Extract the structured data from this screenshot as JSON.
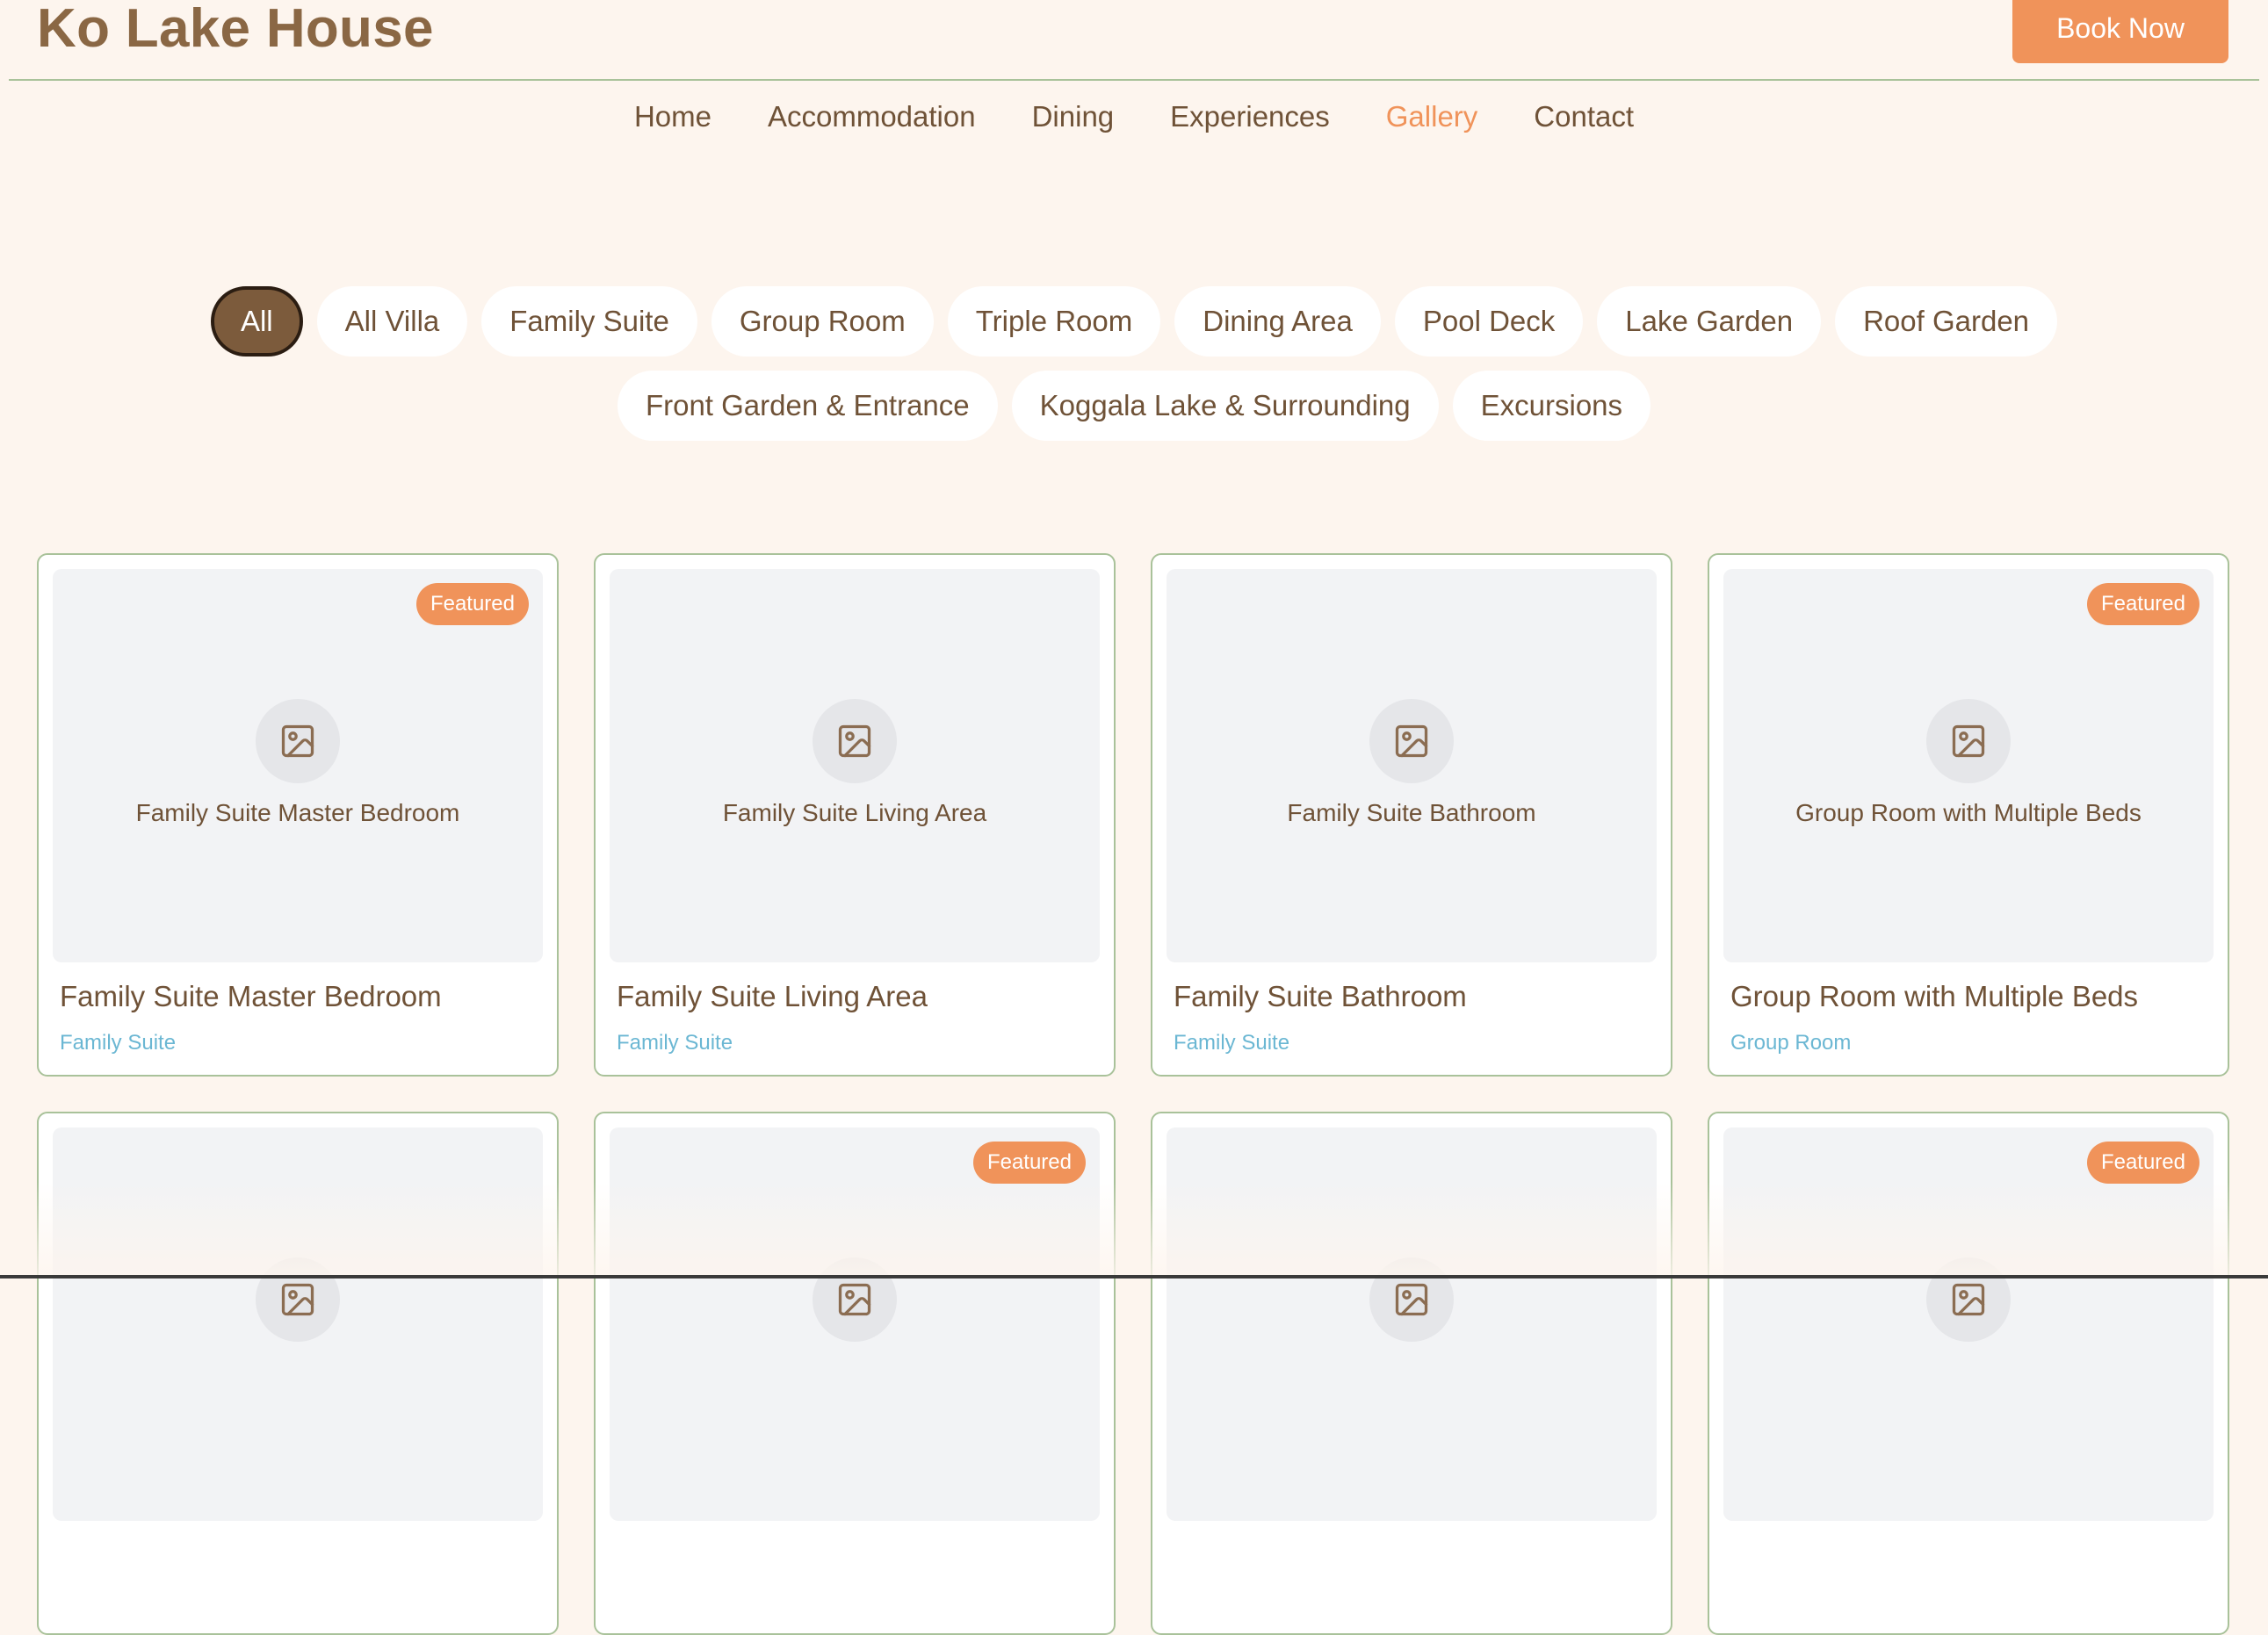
{
  "brand": {
    "name": "Ko Lake House"
  },
  "header": {
    "book_label": "Book Now"
  },
  "nav": {
    "items": [
      {
        "label": "Home",
        "active": false
      },
      {
        "label": "Accommodation",
        "active": false
      },
      {
        "label": "Dining",
        "active": false
      },
      {
        "label": "Experiences",
        "active": false
      },
      {
        "label": "Gallery",
        "active": true
      },
      {
        "label": "Contact",
        "active": false
      }
    ]
  },
  "filters": {
    "selected": "All",
    "items": [
      "All",
      "All Villa",
      "Family Suite",
      "Group Room",
      "Triple Room",
      "Dining Area",
      "Pool Deck",
      "Lake Garden",
      "Roof Garden",
      "Front Garden & Entrance",
      "Koggala Lake & Surrounding",
      "Excursions"
    ]
  },
  "gallery": {
    "items": [
      {
        "caption": "Family Suite Master Bedroom",
        "title": "Family Suite Master Bedroom",
        "category": "Family Suite",
        "featured": true,
        "badge": "Featured",
        "icon": "image-icon"
      },
      {
        "caption": "Family Suite Living Area",
        "title": "Family Suite Living Area",
        "category": "Family Suite",
        "featured": false,
        "badge": "",
        "icon": "image-icon"
      },
      {
        "caption": "Family Suite Bathroom",
        "title": "Family Suite Bathroom",
        "category": "Family Suite",
        "featured": false,
        "badge": "",
        "icon": "image-icon"
      },
      {
        "caption": "Group Room with Multiple Beds",
        "title": "Group Room with Multiple Beds",
        "category": "Group Room",
        "featured": true,
        "badge": "Featured",
        "icon": "image-icon"
      },
      {
        "caption": "",
        "title": "",
        "category": "",
        "featured": false,
        "badge": "",
        "icon": "image-icon"
      },
      {
        "caption": "",
        "title": "",
        "category": "",
        "featured": true,
        "badge": "Featured",
        "icon": "image-icon"
      },
      {
        "caption": "",
        "title": "",
        "category": "",
        "featured": false,
        "badge": "",
        "icon": "image-icon"
      },
      {
        "caption": "",
        "title": "",
        "category": "",
        "featured": true,
        "badge": "Featured",
        "icon": "image-icon"
      }
    ]
  },
  "colors": {
    "background": "#fdf5ee",
    "brand": "#8a6744",
    "accent": "#f0935a",
    "border": "#a9c29a",
    "category": "#6bb7d3",
    "selected_chip": "#7c5b3c"
  }
}
